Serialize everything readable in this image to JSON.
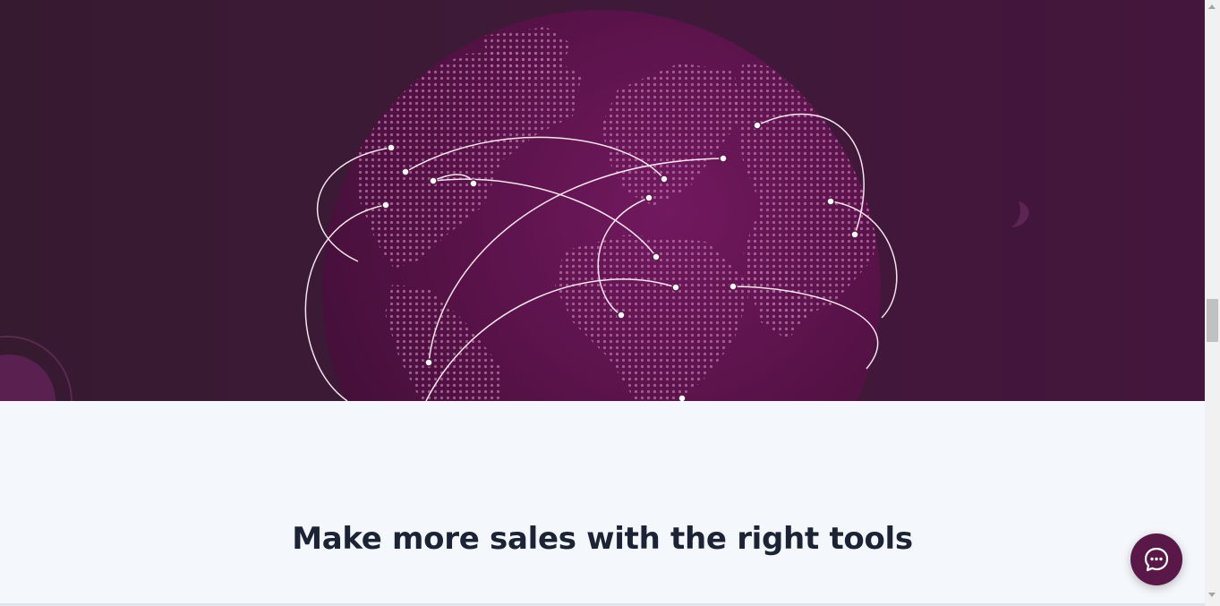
{
  "hero": {
    "image": "globe-network-illustration"
  },
  "section": {
    "headline": "Make more sales with the right tools"
  },
  "chat": {
    "icon": "chat-bubble-icon"
  },
  "colors": {
    "hero_background": "#3e1a38",
    "globe": "#6a1a5c",
    "page_background": "#f4f7fb",
    "headline": "#1b2335",
    "chat_button": "#5a1848"
  }
}
